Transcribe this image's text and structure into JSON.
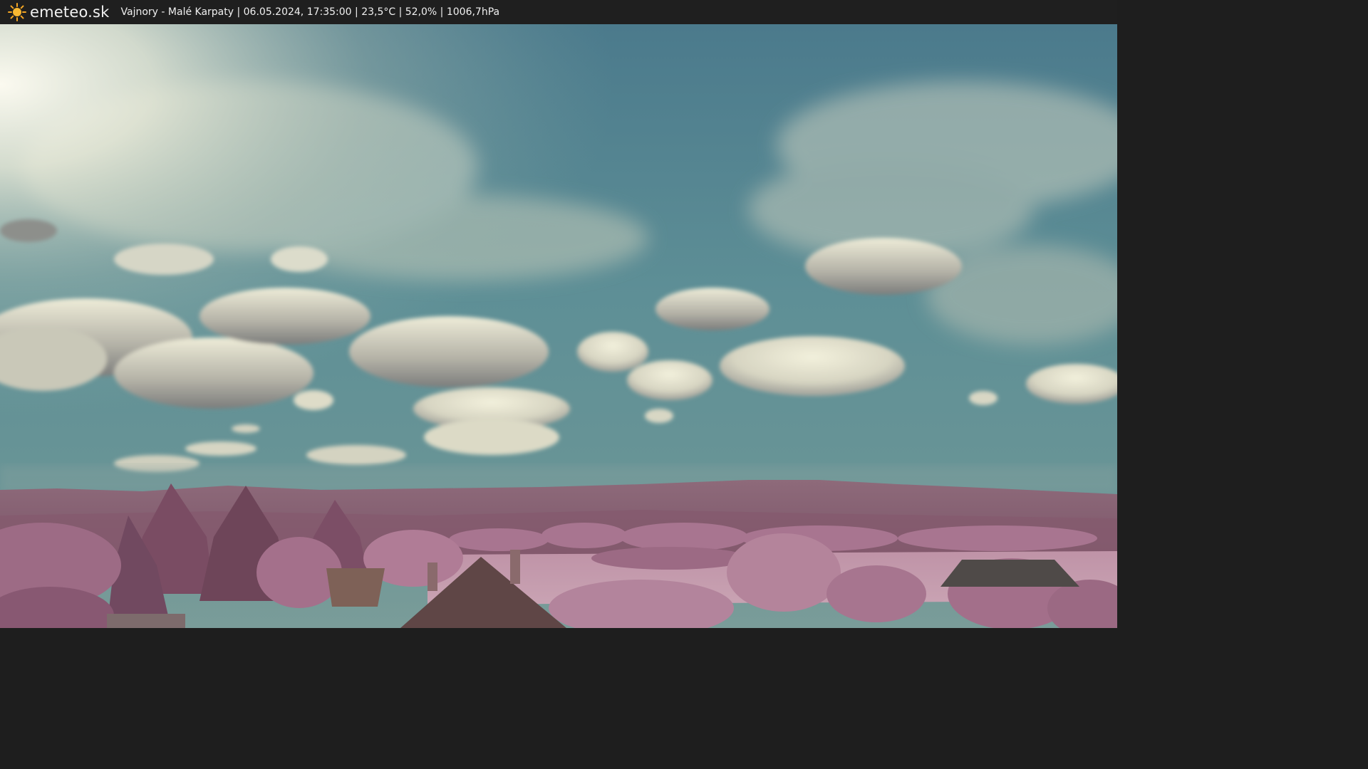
{
  "header": {
    "brand": "emeteo.sk",
    "brand_icon": "sun-icon",
    "caption": "Vajnory - Malé Karpaty | 06.05.2024, 17:35:00 | 23,5°C | 52,0% | 1006,7hPa"
  },
  "colors": {
    "header_bg": "#1f1f1f",
    "sky_top": "#4f7f8f",
    "sky_low": "#5a8c8d",
    "sun_glow": "#f6f5e6",
    "cloud": "#e8e6cf",
    "cloud_shadow": "#8b8a86",
    "hills": "#8a5f73",
    "foliage": "#b27c96",
    "field": "#c49aac",
    "roof": "#6d4f4c"
  }
}
